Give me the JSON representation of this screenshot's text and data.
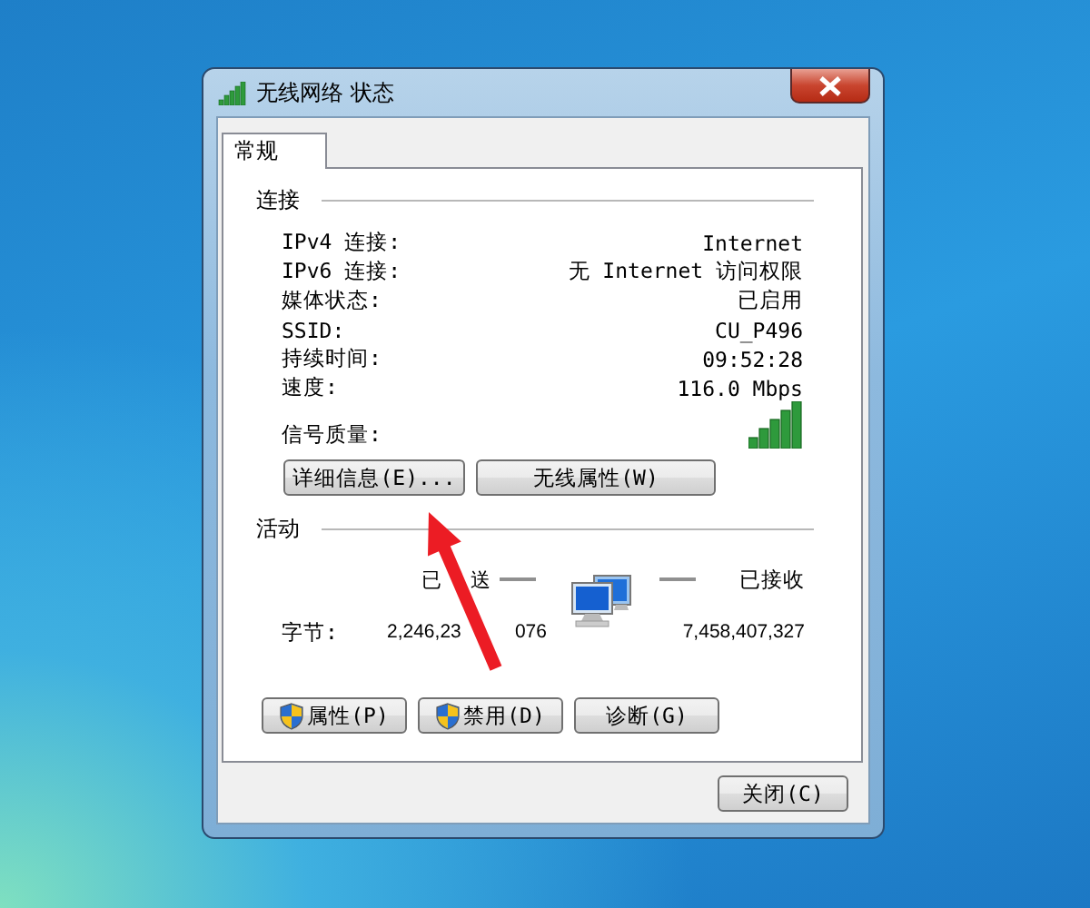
{
  "window": {
    "title": "无线网络 状态"
  },
  "tabs": [
    {
      "label": "常规",
      "selected": true
    }
  ],
  "connection": {
    "heading": "连接",
    "rows": [
      {
        "label": "IPv4 连接:",
        "value": "Internet"
      },
      {
        "label": "IPv6 连接:",
        "value": "无 Internet 访问权限"
      },
      {
        "label": "媒体状态:",
        "value": "已启用"
      },
      {
        "label": "SSID:",
        "value": "CU_P496"
      },
      {
        "label": "持续时间:",
        "value": "09:52:28"
      },
      {
        "label": "速度:",
        "value": "116.0 Mbps"
      }
    ],
    "signal_label": "信号质量:"
  },
  "connection_buttons": [
    "详细信息(E)...",
    "无线属性(W)"
  ],
  "activity": {
    "heading": "活动",
    "sent_label_parts": [
      "已",
      "送"
    ],
    "received_label": "已接收",
    "bytes_label": "字节:",
    "sent_parts": [
      "2,246,23",
      "076"
    ],
    "received": "7,458,407,327"
  },
  "activity_buttons": [
    {
      "label": "属性(P)",
      "shield": true
    },
    {
      "label": "禁用(D)",
      "shield": true
    },
    {
      "label": "诊断(G)",
      "shield": false
    }
  ],
  "close_button": "关闭(C)"
}
